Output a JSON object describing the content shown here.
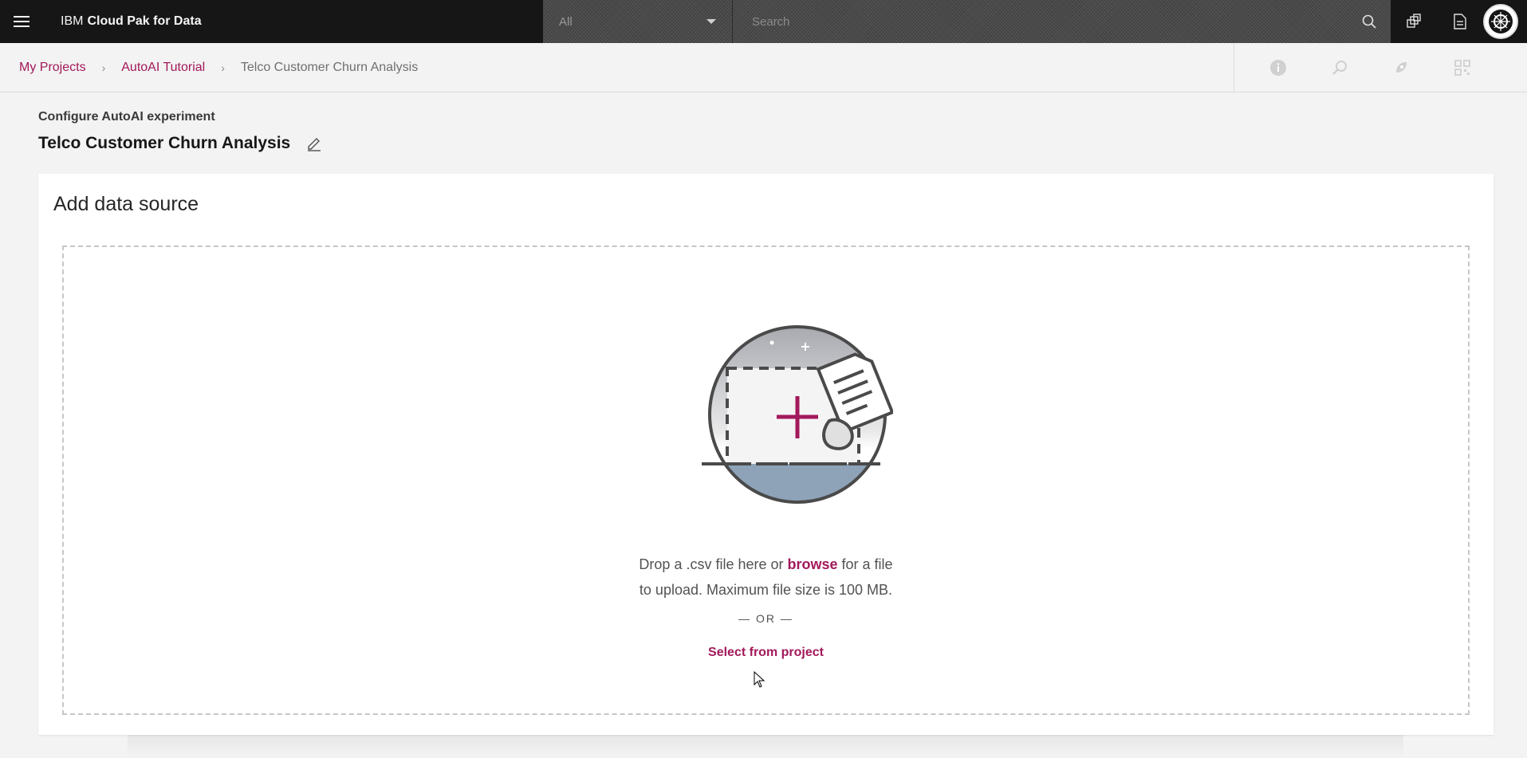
{
  "header": {
    "brand_prefix": "IBM",
    "brand_name": "Cloud Pak for Data",
    "search_scope": "All",
    "search_placeholder": "Search"
  },
  "breadcrumb": {
    "items": [
      "My Projects",
      "AutoAI Tutorial"
    ],
    "current": "Telco Customer Churn Analysis"
  },
  "page": {
    "subtitle": "Configure AutoAI experiment",
    "title": "Telco Customer Churn Analysis"
  },
  "card": {
    "title": "Add data source",
    "drop_text_before": "Drop a .csv file here or ",
    "browse_label": "browse",
    "drop_text_after": " for a file",
    "drop_text_line2": "to upload. Maximum file size is 100 MB.",
    "or_label": "— OR —",
    "select_from_project_label": "Select from project"
  },
  "colors": {
    "accent": "#a2195b",
    "header_bg": "#161616"
  },
  "icons": {
    "header": [
      "menu-icon",
      "search-icon",
      "switcher-icon",
      "document-icon",
      "avatar"
    ],
    "toolbar": [
      "info-icon",
      "lock-search-icon",
      "rocket-icon",
      "qr-grid-icon"
    ]
  }
}
